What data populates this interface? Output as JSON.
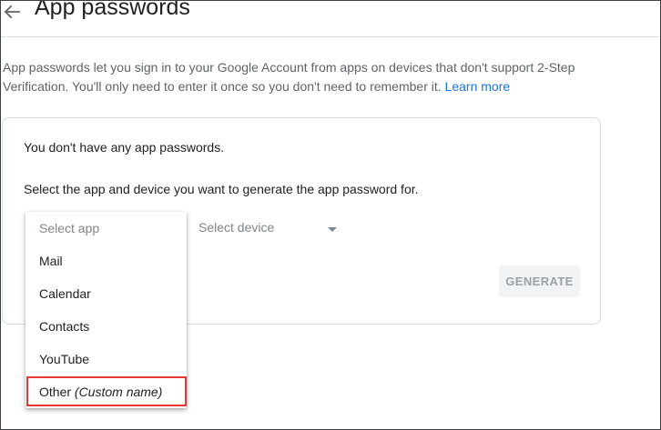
{
  "header": {
    "title": "App passwords",
    "back_icon": "arrow-left-icon"
  },
  "description": {
    "text": "App passwords let you sign in to your Google Account from apps on devices that don't support 2-Step Verification. You'll only need to enter it once so you don't need to remember it.",
    "learn_more": "Learn more"
  },
  "card": {
    "no_passwords": "You don't have any app passwords.",
    "instruction": "Select the app and device you want to generate the app password for.",
    "device_select": {
      "placeholder": "Select device",
      "icon": "caret-down-icon"
    },
    "generate_label": "GENERATE"
  },
  "app_menu": {
    "placeholder": "Select app",
    "items": [
      "Mail",
      "Calendar",
      "Contacts",
      "YouTube"
    ],
    "other": {
      "label": "Other",
      "hint": "(Custom name)"
    }
  },
  "colors": {
    "link": "#1a73e8",
    "highlight": "#e53935",
    "disabled_text": "#9aa0a6"
  }
}
